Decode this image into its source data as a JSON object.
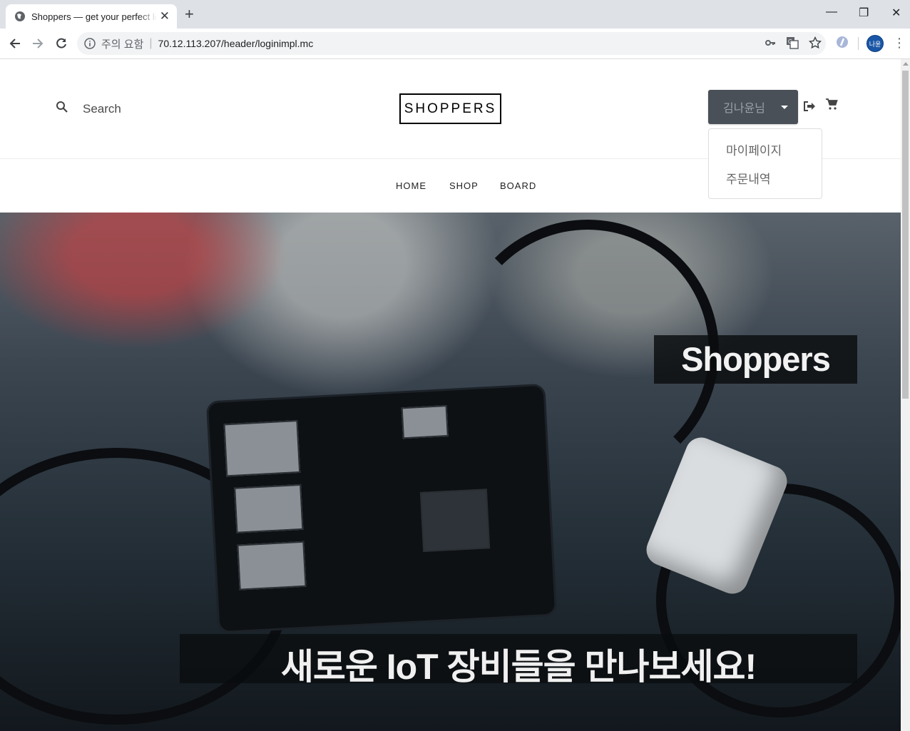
{
  "browser": {
    "tab_title": "Shoppers — get your perfect look",
    "security_label": "주의 요함",
    "url": "70.12.113.207/header/loginimpl.mc",
    "profile_initials": "나윤"
  },
  "header": {
    "search_placeholder": "Search",
    "logo": "SHOPPERS",
    "user_name": "김나윤님",
    "dropdown": [
      "마이페이지",
      "주문내역"
    ]
  },
  "nav": [
    "HOME",
    "SHOP",
    "BOARD"
  ],
  "hero": {
    "title": "Shoppers",
    "subtitle": "새로운 IoT 장비들을 만나보세요!"
  },
  "colors": {
    "user_button_bg": "#495057",
    "tabbar_bg": "#dee1e6",
    "profile_bg": "#1a56a6"
  }
}
